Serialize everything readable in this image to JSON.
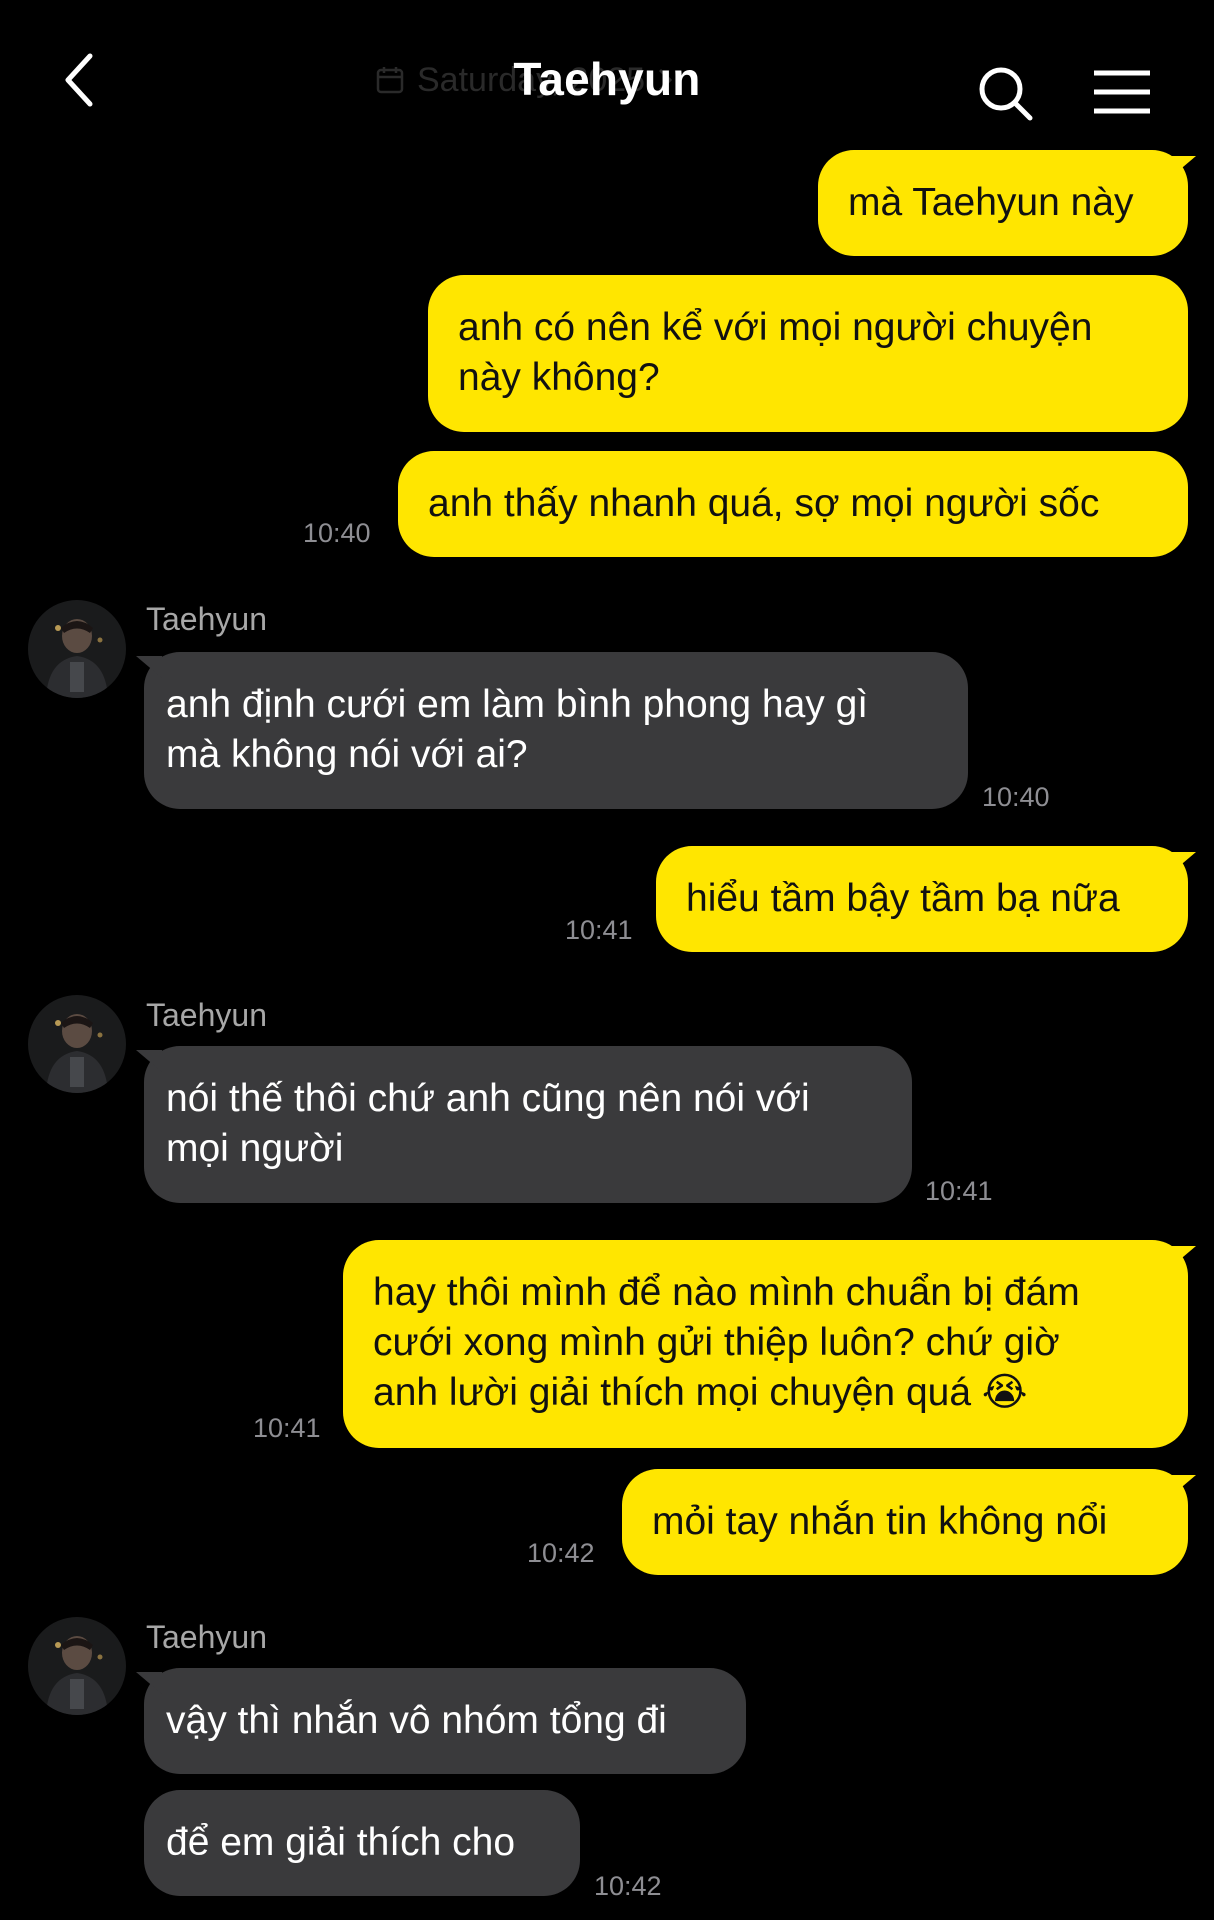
{
  "header": {
    "title": "Taehyun",
    "date_label": "Saturday, 2025"
  },
  "colors": {
    "my_bubble": "#ffe600",
    "their_bubble": "#3a3a3c",
    "background": "#000000",
    "timestamp": "#8e8e93"
  },
  "icons": {
    "back": "chevron-left-icon",
    "search": "search-icon",
    "menu": "menu-icon",
    "calendar": "calendar-icon",
    "date_next": "chevron-right-icon"
  },
  "messages": [
    {
      "from": "me",
      "lines": [
        "mà Taehyun này"
      ]
    },
    {
      "from": "me",
      "lines": [
        "anh có nên kể với mọi người chuyện",
        "này không?"
      ]
    },
    {
      "from": "me",
      "lines": [
        "anh thấy nhanh quá, sợ mọi người sốc"
      ],
      "time": "10:40"
    },
    {
      "from": "them",
      "sender": "Taehyun",
      "lines": [
        "anh định cưới em làm bình phong hay gì",
        "mà không nói với ai?"
      ],
      "time": "10:40"
    },
    {
      "from": "me",
      "lines": [
        "hiểu tầm bậy tầm bạ nữa"
      ],
      "time": "10:41"
    },
    {
      "from": "them",
      "sender": "Taehyun",
      "lines": [
        "nói thế thôi chứ anh cũng nên nói với",
        "mọi người"
      ],
      "time": "10:41"
    },
    {
      "from": "me",
      "lines": [
        "hay thôi mình để nào mình chuẩn bị đám",
        "cưới xong mình gửi thiệp luôn? chứ giờ",
        "anh lười giải thích mọi chuyện quá 😭"
      ],
      "time": "10:41"
    },
    {
      "from": "me",
      "lines": [
        "mỏi tay nhắn tin không nổi"
      ],
      "time": "10:42"
    },
    {
      "from": "them",
      "sender": "Taehyun",
      "lines": [
        "vậy thì nhắn vô nhóm tổng đi"
      ]
    },
    {
      "from": "them",
      "lines": [
        "để em giải thích cho"
      ],
      "time": "10:42"
    }
  ]
}
